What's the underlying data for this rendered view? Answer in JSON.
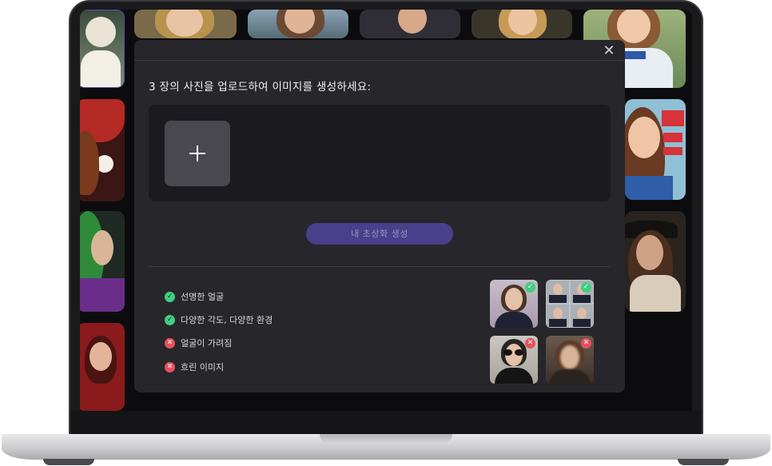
{
  "modal": {
    "title": "3 장의 사진을 업로드하여 이미지를 생성하세요:",
    "close_icon": "close-icon",
    "upload_icon": "plus-icon",
    "generate_label": "내 초상화 생성",
    "colors": {
      "modal_bg": "#27262b",
      "accent": "#4a3f8a",
      "ok": "#3fcf80",
      "bad": "#e8505b"
    }
  },
  "tips": [
    {
      "label": "선명한 얼굴",
      "status": "ok"
    },
    {
      "label": "다양한 각도, 다양한 환경",
      "status": "ok"
    },
    {
      "label": "얼굴이 가려짐",
      "status": "bad"
    },
    {
      "label": "흐린 이미지",
      "status": "bad"
    }
  ],
  "examples": [
    {
      "name": "clear-face-example",
      "status": "ok"
    },
    {
      "name": "multiple-angles-example",
      "status": "ok"
    },
    {
      "name": "covered-face-example",
      "status": "bad"
    },
    {
      "name": "blurry-image-example",
      "status": "bad"
    }
  ],
  "background_tiles": [
    {
      "name": "gallery-portrait-bride"
    },
    {
      "name": "gallery-portrait-woman-blonde"
    },
    {
      "name": "gallery-portrait-beach"
    },
    {
      "name": "gallery-portrait-graduate"
    },
    {
      "name": "gallery-portrait-graduate-2"
    },
    {
      "name": "gallery-portrait-soccer"
    },
    {
      "name": "gallery-portrait-santa"
    },
    {
      "name": "gallery-portrait-magazine"
    },
    {
      "name": "gallery-portrait-green-hair"
    },
    {
      "name": "gallery-portrait-pirate"
    },
    {
      "name": "gallery-portrait-red"
    }
  ]
}
